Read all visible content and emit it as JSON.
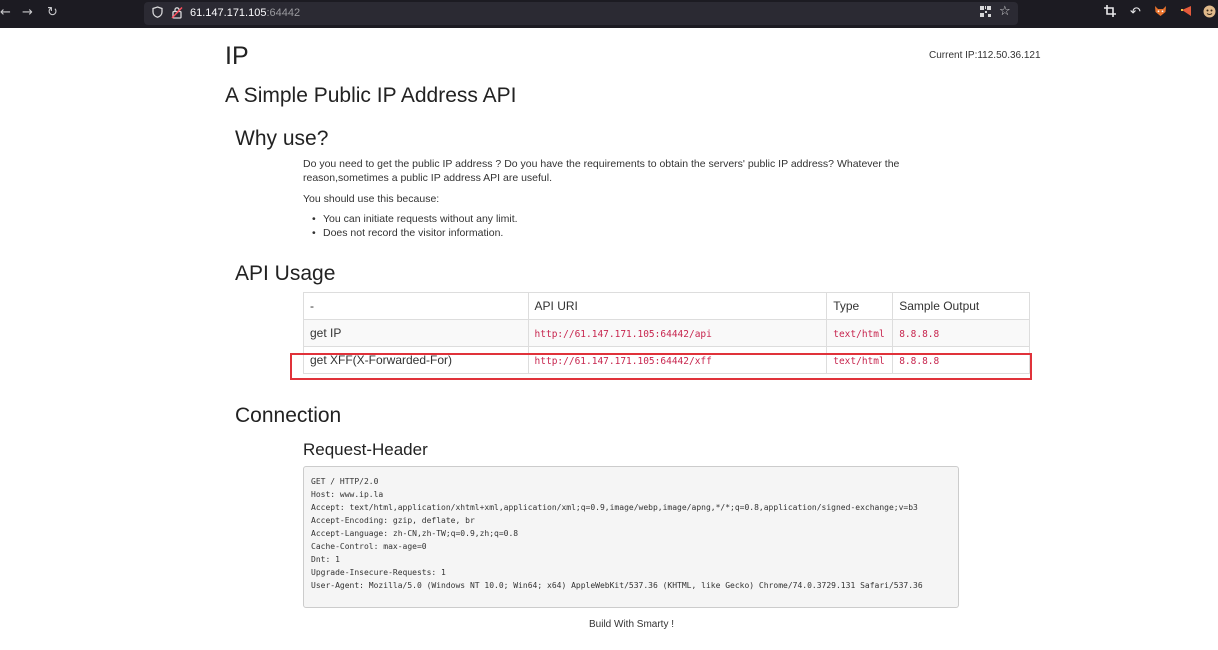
{
  "browser": {
    "url_host": "61.147.171.105",
    "url_port": ":64442",
    "icons": [
      "back-arrow-icon",
      "forward-arrow-icon",
      "reload-icon",
      "shield-icon",
      "lock-warning-icon",
      "qr-code-icon",
      "bookmark-star-icon",
      "crop-icon",
      "undo-icon",
      "fox-extension-icon",
      "pin-extension-icon",
      "avatar-extension-icon"
    ]
  },
  "page": {
    "title": "IP",
    "current_ip_label": "Current IP:112.50.36.121",
    "subtitle": "A Simple Public IP Address API"
  },
  "why": {
    "heading": "Why use?",
    "para1": "Do you need to get the public IP address ? Do you have the requirements to obtain the servers' public IP address? Whatever the reason,sometimes a public IP address API are useful.",
    "para2": "You should use this because:",
    "bullets": [
      "You can initiate requests without any limit.",
      "Does not record the visitor information."
    ]
  },
  "api": {
    "heading": "API Usage",
    "headers": [
      "-",
      "API URI",
      "Type",
      "Sample Output"
    ],
    "rows": [
      {
        "name": "get IP",
        "uri": "http://61.147.171.105:64442/api",
        "type": "text/html",
        "output": "8.8.8.8"
      },
      {
        "name": "get XFF(X-Forwarded-For)",
        "uri": "http://61.147.171.105:64442/xff",
        "type": "text/html",
        "output": "8.8.8.8"
      }
    ]
  },
  "connection": {
    "heading": "Connection",
    "subheading": "Request-Header",
    "request_header": "GET / HTTP/2.0\nHost: www.ip.la\nAccept: text/html,application/xhtml+xml,application/xml;q=0.9,image/webp,image/apng,*/*;q=0.8,application/signed-exchange;v=b3\nAccept-Encoding: gzip, deflate, br\nAccept-Language: zh-CN,zh-TW;q=0.9,zh;q=0.8\nCache-Control: max-age=0\nDnt: 1\nUpgrade-Insecure-Requests: 1\nUser-Agent: Mozilla/5.0 (Windows NT 10.0; Win64; x64) AppleWebKit/537.36 (KHTML, like Gecko) Chrome/74.0.3729.131 Safari/537.36"
  },
  "footer": {
    "text": "Build With Smarty !"
  },
  "colors": {
    "code": "#c7254e",
    "highlight": "#e0323a",
    "chrome": "#1c1b22"
  }
}
